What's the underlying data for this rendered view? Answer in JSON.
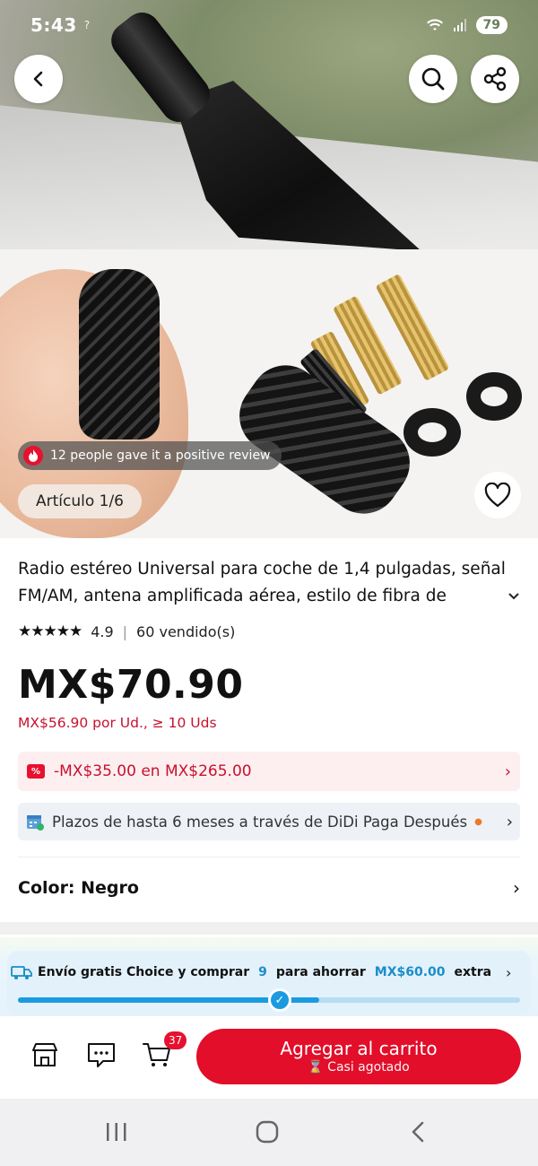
{
  "status_bar": {
    "time": "5:43",
    "extra": "?",
    "battery": "79"
  },
  "hero": {
    "review_text": "12 people gave it a positive review",
    "article_label": "Artículo 1/6"
  },
  "product": {
    "title": "Radio estéreo Universal para coche de 1,4 pulgadas, señal FM/AM, antena amplificada aérea, estilo de fibra de",
    "rating": "4.9",
    "sold": "60 vendido(s)",
    "price": "MX$70.90",
    "bulk_price": "MX$56.90 por Ud., ≥ 10 Uds"
  },
  "promo": {
    "icon_text": "%",
    "text": "-MX$35.00 en MX$265.00"
  },
  "installment": {
    "text": "Plazos de hasta 6 meses a través de DiDi Paga Después"
  },
  "color": {
    "label": "Color: Negro"
  },
  "shipping": {
    "prefix": "Envío gratis Choice y comprar",
    "count": "9",
    "middle": "para ahorrar",
    "amount": "MX$60.00",
    "suffix": "extra",
    "progress": 0.6
  },
  "action_bar": {
    "cart_count": "37",
    "add_to_cart": "Agregar al carrito",
    "stock_note": "Casi agotado"
  },
  "colors": {
    "accent_red": "#e20e2a",
    "promo_red": "#c8102e",
    "ship_blue": "#1a9be0"
  }
}
